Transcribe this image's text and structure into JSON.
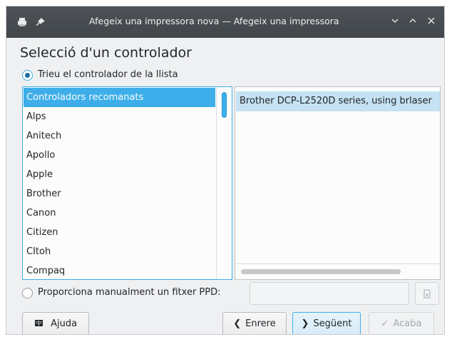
{
  "window": {
    "title": "Afegeix una impressora nova — Afegeix una impressora",
    "icons": [
      "printer-icon",
      "pin-icon"
    ],
    "controls": [
      "minimize-icon",
      "maximize-icon",
      "close-icon"
    ]
  },
  "page": {
    "heading": "Selecció d'un controlador"
  },
  "options": {
    "list_radio_label": "Trieu el controlador de la llista",
    "list_radio_checked": true,
    "ppd_radio_label": "Proporciona manualment un fitxer PPD:",
    "ppd_radio_checked": false,
    "ppd_value": ""
  },
  "manufacturers": {
    "items": [
      "Controladors recomanats",
      "Alps",
      "Anitech",
      "Apollo",
      "Apple",
      "Brother",
      "Canon",
      "Citizen",
      "CItoh",
      "Compaq"
    ],
    "selected_index": 0
  },
  "drivers": {
    "items": [
      "Brother DCP-L2520D series, using brlaser"
    ],
    "selected_index": 0
  },
  "buttons": {
    "help": "Ajuda",
    "back": "Enrere",
    "next": "Següent",
    "finish": "Acaba"
  },
  "colors": {
    "accent": "#3daee9",
    "titlebar": "#475057",
    "window_bg": "#eff0f1"
  }
}
